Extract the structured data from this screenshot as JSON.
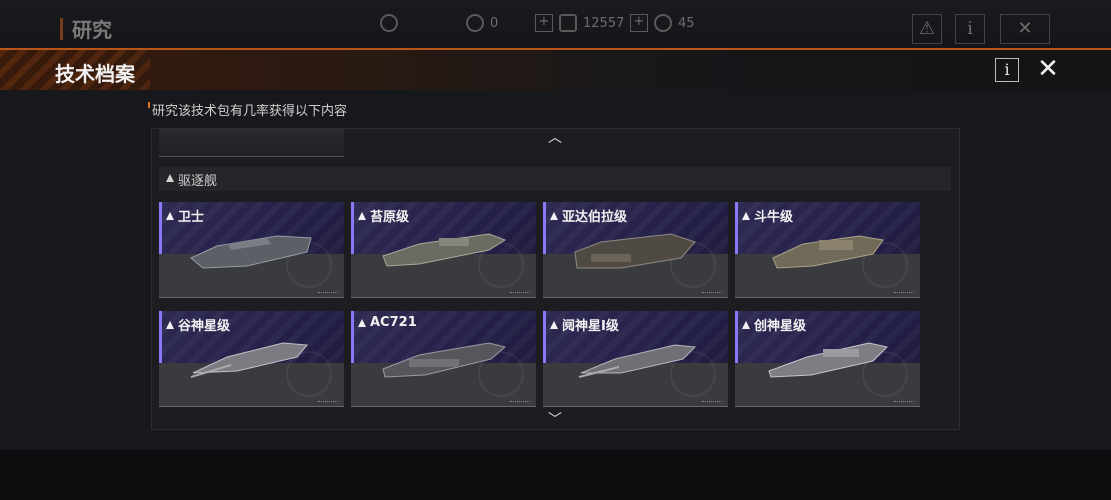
{
  "background": {
    "title": "研究",
    "resources": [
      {
        "icon": "refresh-icon",
        "value": ""
      },
      {
        "icon": "token-icon",
        "value": "0"
      },
      {
        "icon": "crystal-icon",
        "value": "12557"
      },
      {
        "icon": "coin-icon",
        "value": "45"
      }
    ]
  },
  "header": {
    "title": "技术档案",
    "info_label": "i",
    "close_label": "✕"
  },
  "subtitle": "研究该技术包有几率获得以下内容",
  "section": {
    "label": "驱逐舰"
  },
  "ships": [
    {
      "name": "卫士"
    },
    {
      "name": "苔原级"
    },
    {
      "name": "亚达伯拉级"
    },
    {
      "name": "斗牛级"
    },
    {
      "name": "谷神星级"
    },
    {
      "name": "AC721"
    },
    {
      "name": "阋神星I级"
    },
    {
      "name": "创神星级"
    }
  ],
  "colors": {
    "accent": "#b8561a",
    "card_accent": "#8a78ff",
    "card_top": "#2e2a52"
  }
}
